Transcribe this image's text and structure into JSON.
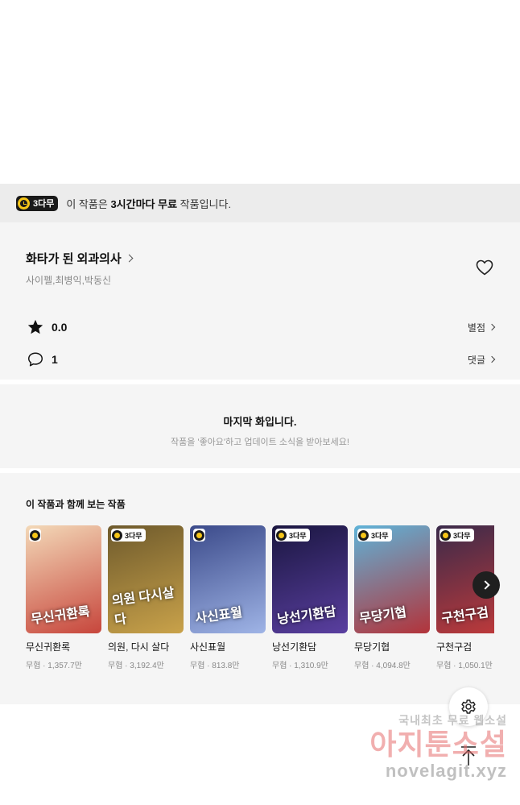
{
  "banner": {
    "badge": "3다무",
    "prefix": "이 작품은 ",
    "bold": "3시간마다 무료",
    "suffix": " 작품입니다."
  },
  "work": {
    "title": "화타가 된 외과의사",
    "authors": "사이펠,최병익,박동신",
    "rating": "0.0",
    "rating_link": "별점",
    "comments": "1",
    "comments_link": "댓글"
  },
  "last_episode": {
    "title": "마지막 화입니다.",
    "subtitle": "작품을 '좋아요'하고 업데이트 소식을 받아보세요!"
  },
  "recommendations": {
    "heading": "이 작품과 함께 보는 작품",
    "items": [
      {
        "name": "무신귀환록",
        "meta": "무협 · 1,357.7만",
        "badge": "",
        "cover_text": "무신귀환록",
        "colors": [
          "#f3d9b8",
          "#c7463c"
        ]
      },
      {
        "name": "의원, 다시 살다",
        "meta": "무협 · 3,192.4만",
        "badge": "3다무",
        "cover_text": "의원 다시살다",
        "colors": [
          "#6e5a2c",
          "#c9a24a"
        ]
      },
      {
        "name": "사신표월",
        "meta": "무협 · 813.8만",
        "badge": "",
        "cover_text": "사신표월",
        "colors": [
          "#3b4a8a",
          "#9fb4e6"
        ]
      },
      {
        "name": "낭선기환담",
        "meta": "무협 · 1,310.9만",
        "badge": "3다무",
        "cover_text": "낭선기환담",
        "colors": [
          "#1a1640",
          "#5a3fa0"
        ]
      },
      {
        "name": "무당기협",
        "meta": "무협 · 4,094.8만",
        "badge": "3다무",
        "cover_text": "무당기협",
        "colors": [
          "#5fb3d8",
          "#b3333a"
        ]
      },
      {
        "name": "구천구검",
        "meta": "무협 · 1,050.1만",
        "badge": "3다무",
        "cover_text": "구천구검",
        "colors": [
          "#3a2a4a",
          "#c23a3a"
        ]
      }
    ]
  },
  "watermark": {
    "line1": "국내최초 무료 웹소설",
    "line2": "아지툰소설",
    "line3": "novelagit.xyz"
  }
}
